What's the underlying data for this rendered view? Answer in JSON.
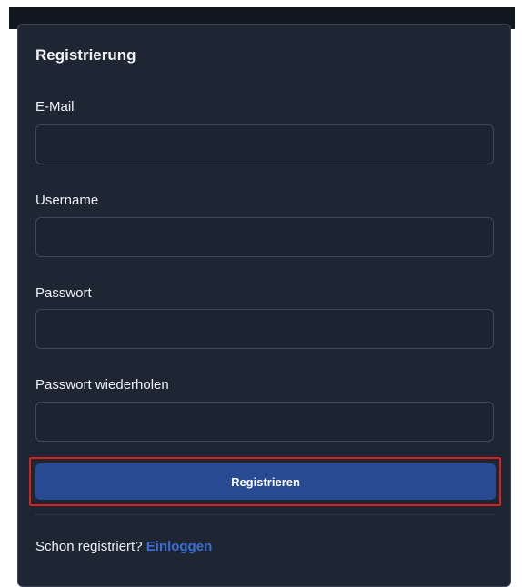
{
  "form": {
    "title": "Registrierung",
    "fields": [
      {
        "label": "E-Mail",
        "value": "",
        "placeholder": ""
      },
      {
        "label": "Username",
        "value": "",
        "placeholder": ""
      },
      {
        "label": "Passwort",
        "value": "",
        "placeholder": ""
      },
      {
        "label": "Passwort wiederholen",
        "value": "",
        "placeholder": ""
      }
    ],
    "submit_label": "Registrieren",
    "footer_text": "Schon registriert?",
    "footer_link": "Einloggen"
  },
  "colors": {
    "card_bg": "#1e2533",
    "button_bg": "#274a93",
    "link": "#3b6fd1",
    "highlight_border": "#d8201e"
  }
}
